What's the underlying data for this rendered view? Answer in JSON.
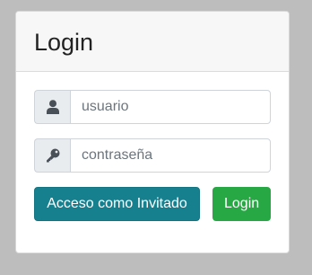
{
  "card": {
    "title": "Login"
  },
  "form": {
    "username": {
      "icon": "user-icon",
      "placeholder": "usuario",
      "value": ""
    },
    "password": {
      "icon": "key-icon",
      "placeholder": "contraseña",
      "value": ""
    }
  },
  "buttons": {
    "guest_label": "Acceso como Invitado",
    "login_label": "Login"
  },
  "colors": {
    "guest_button": "#17808f",
    "login_button": "#28a745",
    "backdrop": "#bdbdbd"
  }
}
